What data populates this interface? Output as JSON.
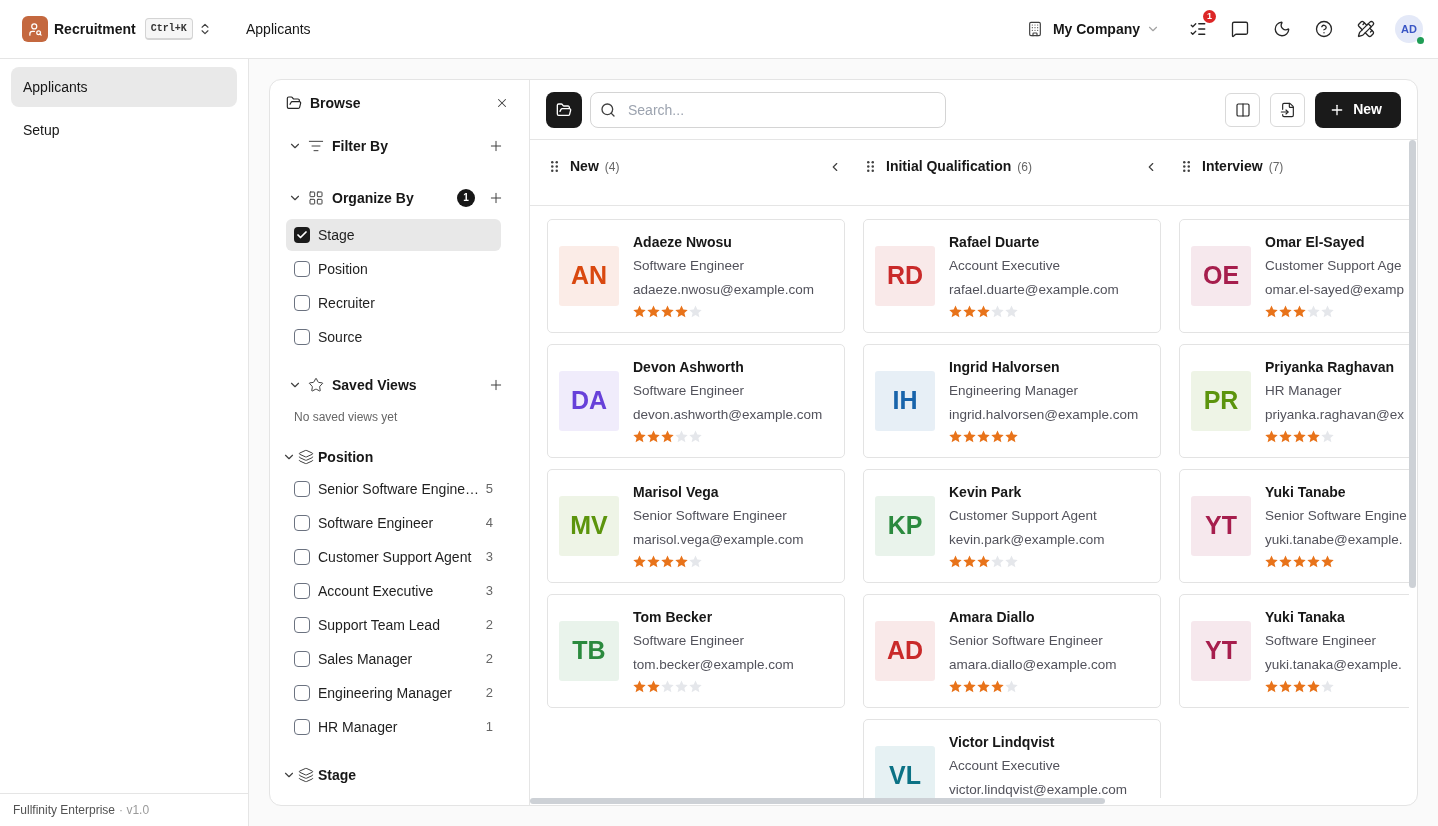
{
  "header": {
    "app_name": "Recruitment",
    "shortcut": "Ctrl+K",
    "breadcrumb": "Applicants",
    "company": "My Company",
    "task_badge": "1",
    "user_initials": "AD",
    "user_online": true
  },
  "sidebar": {
    "items": [
      {
        "label": "Applicants",
        "selected": true
      },
      {
        "label": "Setup",
        "selected": false
      }
    ],
    "footer": {
      "product": "Fullfinity Enterprise",
      "version": "· v1.0"
    }
  },
  "browse": {
    "title": "Browse",
    "sections": [
      {
        "kind": "filter",
        "title": "Filter By",
        "expanded": true
      },
      {
        "kind": "organize",
        "title": "Organize By",
        "expanded": true,
        "badge": "1",
        "options": [
          {
            "label": "Stage",
            "checked": true
          },
          {
            "label": "Position",
            "checked": false
          },
          {
            "label": "Recruiter",
            "checked": false
          },
          {
            "label": "Source",
            "checked": false
          }
        ]
      },
      {
        "kind": "saved",
        "title": "Saved Views",
        "expanded": true,
        "empty_text": "No saved views yet"
      },
      {
        "kind": "group",
        "title": "Position",
        "expanded": true,
        "options": [
          {
            "label": "Senior Software Engine…",
            "count": "5",
            "checked": false
          },
          {
            "label": "Software Engineer",
            "count": "4",
            "checked": false
          },
          {
            "label": "Customer Support Agent",
            "count": "3",
            "checked": false
          },
          {
            "label": "Account Executive",
            "count": "3",
            "checked": false
          },
          {
            "label": "Support Team Lead",
            "count": "2",
            "checked": false
          },
          {
            "label": "Sales Manager",
            "count": "2",
            "checked": false
          },
          {
            "label": "Engineering Manager",
            "count": "2",
            "checked": false
          },
          {
            "label": "HR Manager",
            "count": "1",
            "checked": false
          }
        ]
      },
      {
        "kind": "group",
        "title": "Stage",
        "expanded": true
      }
    ]
  },
  "toolbar": {
    "search": {
      "placeholder": "Search..."
    },
    "new_button": "New"
  },
  "columns": [
    {
      "title": "New",
      "count": "(4)",
      "cards": [
        {
          "initials": "AN",
          "name": "Adaeze Nwosu",
          "position": "Software Engineer",
          "email": "adaeze.nwosu@example.com",
          "stars": 4,
          "color": "#d9480f"
        },
        {
          "initials": "DA",
          "name": "Devon Ashworth",
          "position": "Software Engineer",
          "email": "devon.ashworth@example.com",
          "stars": 3,
          "color": "#6741d9"
        },
        {
          "initials": "MV",
          "name": "Marisol Vega",
          "position": "Senior Software Engineer",
          "email": "marisol.vega@example.com",
          "stars": 4,
          "color": "#5c940d"
        },
        {
          "initials": "TB",
          "name": "Tom Becker",
          "position": "Software Engineer",
          "email": "tom.becker@example.com",
          "stars": 2,
          "color": "#2b8a3e"
        }
      ]
    },
    {
      "title": "Initial Qualification",
      "count": "(6)",
      "cards": [
        {
          "initials": "RD",
          "name": "Rafael Duarte",
          "position": "Account Executive",
          "email": "rafael.duarte@example.com",
          "stars": 3,
          "color": "#c92a2a"
        },
        {
          "initials": "IH",
          "name": "Ingrid Halvorsen",
          "position": "Engineering Manager",
          "email": "ingrid.halvorsen@example.com",
          "stars": 5,
          "color": "#1864ab"
        },
        {
          "initials": "KP",
          "name": "Kevin Park",
          "position": "Customer Support Agent",
          "email": "kevin.park@example.com",
          "stars": 3,
          "color": "#2b8a3e"
        },
        {
          "initials": "AD",
          "name": "Amara Diallo",
          "position": "Senior Software Engineer",
          "email": "amara.diallo@example.com",
          "stars": 4,
          "color": "#c92a2a"
        },
        {
          "initials": "VL",
          "name": "Victor Lindqvist",
          "position": "Account Executive",
          "email": "victor.lindqvist@example.com",
          "color": "#0b7285"
        }
      ]
    },
    {
      "title": "Interview",
      "count": "(7)",
      "cards": [
        {
          "initials": "OE",
          "name": "Omar El-Sayed",
          "position": "Customer Support Age",
          "email": "omar.el-sayed@examp",
          "stars": 3,
          "color": "#a61e4d"
        },
        {
          "initials": "PR",
          "name": "Priyanka Raghavan",
          "position": "HR Manager",
          "email": "priyanka.raghavan@ex",
          "stars": 4,
          "color": "#5c940d"
        },
        {
          "initials": "YT",
          "name": "Yuki Tanabe",
          "position": "Senior Software Engine",
          "email": "yuki.tanabe@example.",
          "stars": 5,
          "color": "#a61e4d"
        },
        {
          "initials": "YT",
          "name": "Yuki Tanaka",
          "position": "Software Engineer",
          "email": "yuki.tanaka@example.",
          "stars": 4,
          "color": "#a61e4d"
        }
      ]
    }
  ]
}
